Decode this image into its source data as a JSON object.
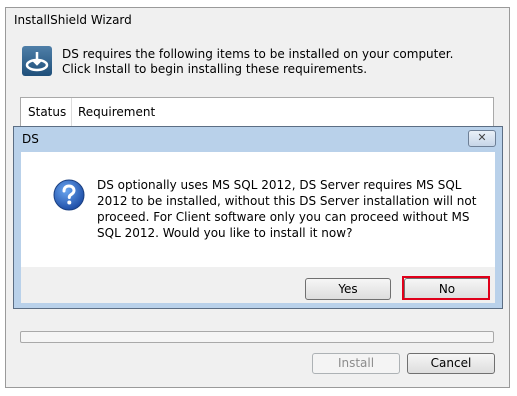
{
  "wizard": {
    "title": "InstallShield Wizard",
    "description": "DS requires the following items to be installed on your computer. Click Install to begin installing these requirements.",
    "table": {
      "columns": [
        "Status",
        "Requirement"
      ]
    },
    "buttons": {
      "install": "Install",
      "cancel": "Cancel"
    }
  },
  "dialog": {
    "title": "DS",
    "close": "✕",
    "message": "DS optionally uses MS SQL 2012, DS Server requires MS SQL 2012 to be installed, without this DS Server installation will not proceed. For Client software only you can proceed without MS SQL 2012. Would you like to install it now?",
    "buttons": {
      "yes": "Yes",
      "no": "No"
    }
  },
  "colors": {
    "highlight": "#e0001a",
    "question_icon": "#1f5fb8"
  }
}
